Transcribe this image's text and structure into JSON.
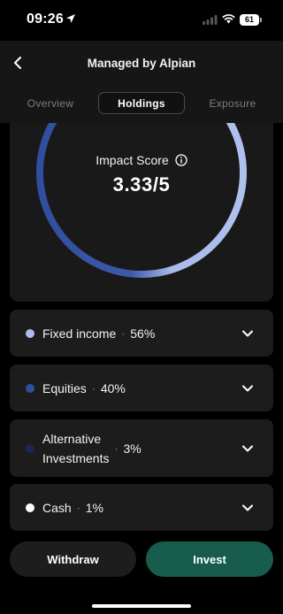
{
  "status_bar": {
    "time": "09:26",
    "battery": "61"
  },
  "header": {
    "title": "Managed by Alpian",
    "back_icon": "chevron-left-icon"
  },
  "tabs": [
    {
      "label": "Overview",
      "active": false
    },
    {
      "label": "Holdings",
      "active": true
    },
    {
      "label": "Exposure",
      "active": false
    }
  ],
  "impact": {
    "label": "Impact Score",
    "value": "3.33/5",
    "info_icon": "info-icon"
  },
  "allocations": [
    {
      "name": "Fixed income",
      "percent": "56%",
      "color": "#a9bbe8"
    },
    {
      "name": "Equities",
      "percent": "40%",
      "color": "#2f4e9e"
    },
    {
      "name_line1": "Alternative",
      "name_line2": "Investments",
      "percent": "3%",
      "color": "#1b2657"
    },
    {
      "name": "Cash",
      "percent": "1%",
      "color": "#ffffff"
    }
  ],
  "actions": {
    "withdraw": "Withdraw",
    "invest": "Invest"
  },
  "colors": {
    "invest_button": "#175c4c",
    "ring_start": "#2f4e9e",
    "ring_end": "#a9bbe8"
  }
}
